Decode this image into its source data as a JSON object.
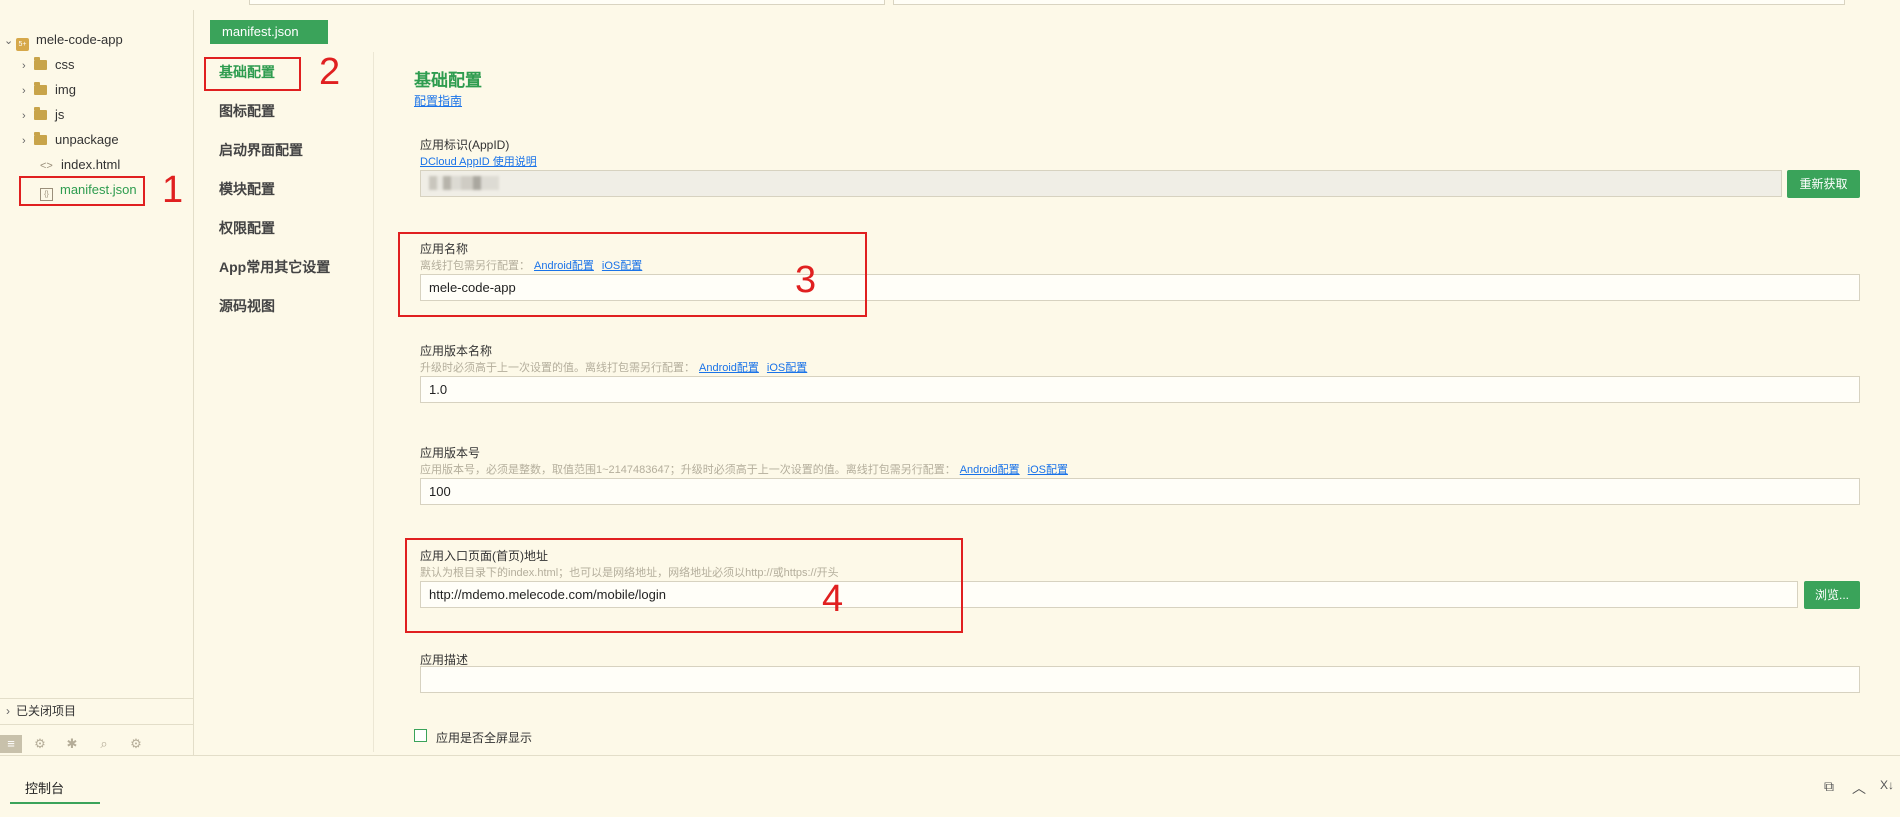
{
  "tab": {
    "file_name": "manifest.json"
  },
  "file_tree": {
    "project": "mele-code-app",
    "items": [
      {
        "label": "css"
      },
      {
        "label": "img"
      },
      {
        "label": "js"
      },
      {
        "label": "unpackage"
      },
      {
        "label": "index.html"
      },
      {
        "label": "manifest.json"
      }
    ],
    "closed_projects": "已关闭项目"
  },
  "nav": {
    "items": [
      {
        "label": "基础配置"
      },
      {
        "label": "图标配置"
      },
      {
        "label": "启动界面配置"
      },
      {
        "label": "模块配置"
      },
      {
        "label": "权限配置"
      },
      {
        "label": "App常用其它设置"
      },
      {
        "label": "源码视图"
      }
    ]
  },
  "content": {
    "title": "基础配置",
    "guide_link": "配置指南",
    "appid": {
      "label": "应用标识(AppID)",
      "help_link": "DCloud AppID 使用说明",
      "refresh_button": "重新获取"
    },
    "app_name": {
      "label": "应用名称",
      "hint": "离线打包需另行配置：",
      "android_link": "Android配置",
      "ios_link": "iOS配置",
      "value": "mele-code-app"
    },
    "version_name": {
      "label": "应用版本名称",
      "hint": "升级时必须高于上一次设置的值。离线打包需另行配置：",
      "android_link": "Android配置",
      "ios_link": "iOS配置",
      "value": "1.0"
    },
    "version_code": {
      "label": "应用版本号",
      "hint": "应用版本号，必须是整数，取值范围1~2147483647；升级时必须高于上一次设置的值。离线打包需另行配置：",
      "android_link": "Android配置",
      "ios_link": "iOS配置",
      "value": "100"
    },
    "entry_page": {
      "label": "应用入口页面(首页)地址",
      "hint": "默认为根目录下的index.html；也可以是网络地址，网络地址必须以http://或https://开头",
      "value": "http://mdemo.melecode.com/mobile/login",
      "browse_button": "浏览..."
    },
    "description": {
      "label": "应用描述",
      "value": ""
    },
    "fullscreen": {
      "label": "应用是否全屏显示"
    }
  },
  "annotations": [
    "1",
    "2",
    "3",
    "4"
  ],
  "bottom": {
    "console_tab": "控制台"
  },
  "colors": {
    "accent": "#3aa35a",
    "annotation": "#e02020",
    "link": "#1a73e8",
    "background": "#fdf9e8"
  }
}
